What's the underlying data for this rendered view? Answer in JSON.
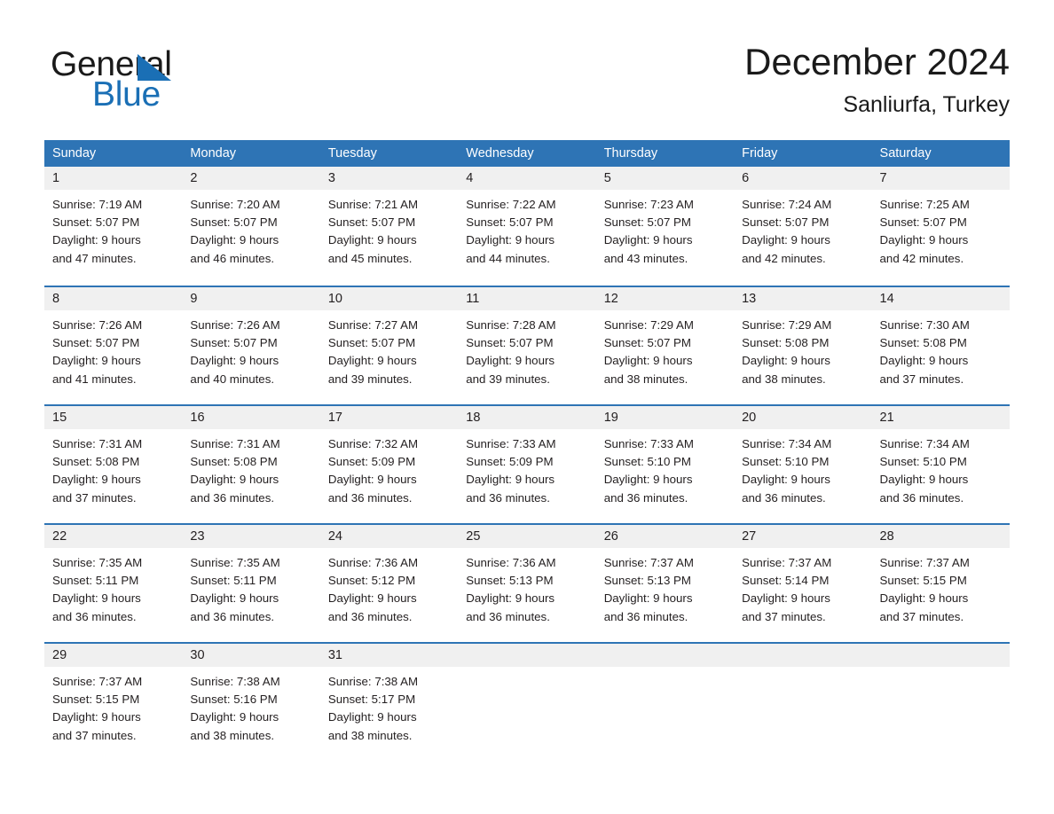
{
  "brand": {
    "word_general": "General",
    "word_blue": "Blue",
    "triangle_color": "#1a6fb5"
  },
  "header": {
    "month_title": "December 2024",
    "location": "Sanliurfa, Turkey"
  },
  "theme": {
    "header_blue": "#2e74b5",
    "day_band_gray": "#f0f0f0",
    "text_color": "#231f20"
  },
  "weekdays": [
    "Sunday",
    "Monday",
    "Tuesday",
    "Wednesday",
    "Thursday",
    "Friday",
    "Saturday"
  ],
  "weeks": [
    [
      {
        "day": "1",
        "sunrise": "Sunrise: 7:19 AM",
        "sunset": "Sunset: 5:07 PM",
        "daylight1": "Daylight: 9 hours",
        "daylight2": "and 47 minutes."
      },
      {
        "day": "2",
        "sunrise": "Sunrise: 7:20 AM",
        "sunset": "Sunset: 5:07 PM",
        "daylight1": "Daylight: 9 hours",
        "daylight2": "and 46 minutes."
      },
      {
        "day": "3",
        "sunrise": "Sunrise: 7:21 AM",
        "sunset": "Sunset: 5:07 PM",
        "daylight1": "Daylight: 9 hours",
        "daylight2": "and 45 minutes."
      },
      {
        "day": "4",
        "sunrise": "Sunrise: 7:22 AM",
        "sunset": "Sunset: 5:07 PM",
        "daylight1": "Daylight: 9 hours",
        "daylight2": "and 44 minutes."
      },
      {
        "day": "5",
        "sunrise": "Sunrise: 7:23 AM",
        "sunset": "Sunset: 5:07 PM",
        "daylight1": "Daylight: 9 hours",
        "daylight2": "and 43 minutes."
      },
      {
        "day": "6",
        "sunrise": "Sunrise: 7:24 AM",
        "sunset": "Sunset: 5:07 PM",
        "daylight1": "Daylight: 9 hours",
        "daylight2": "and 42 minutes."
      },
      {
        "day": "7",
        "sunrise": "Sunrise: 7:25 AM",
        "sunset": "Sunset: 5:07 PM",
        "daylight1": "Daylight: 9 hours",
        "daylight2": "and 42 minutes."
      }
    ],
    [
      {
        "day": "8",
        "sunrise": "Sunrise: 7:26 AM",
        "sunset": "Sunset: 5:07 PM",
        "daylight1": "Daylight: 9 hours",
        "daylight2": "and 41 minutes."
      },
      {
        "day": "9",
        "sunrise": "Sunrise: 7:26 AM",
        "sunset": "Sunset: 5:07 PM",
        "daylight1": "Daylight: 9 hours",
        "daylight2": "and 40 minutes."
      },
      {
        "day": "10",
        "sunrise": "Sunrise: 7:27 AM",
        "sunset": "Sunset: 5:07 PM",
        "daylight1": "Daylight: 9 hours",
        "daylight2": "and 39 minutes."
      },
      {
        "day": "11",
        "sunrise": "Sunrise: 7:28 AM",
        "sunset": "Sunset: 5:07 PM",
        "daylight1": "Daylight: 9 hours",
        "daylight2": "and 39 minutes."
      },
      {
        "day": "12",
        "sunrise": "Sunrise: 7:29 AM",
        "sunset": "Sunset: 5:07 PM",
        "daylight1": "Daylight: 9 hours",
        "daylight2": "and 38 minutes."
      },
      {
        "day": "13",
        "sunrise": "Sunrise: 7:29 AM",
        "sunset": "Sunset: 5:08 PM",
        "daylight1": "Daylight: 9 hours",
        "daylight2": "and 38 minutes."
      },
      {
        "day": "14",
        "sunrise": "Sunrise: 7:30 AM",
        "sunset": "Sunset: 5:08 PM",
        "daylight1": "Daylight: 9 hours",
        "daylight2": "and 37 minutes."
      }
    ],
    [
      {
        "day": "15",
        "sunrise": "Sunrise: 7:31 AM",
        "sunset": "Sunset: 5:08 PM",
        "daylight1": "Daylight: 9 hours",
        "daylight2": "and 37 minutes."
      },
      {
        "day": "16",
        "sunrise": "Sunrise: 7:31 AM",
        "sunset": "Sunset: 5:08 PM",
        "daylight1": "Daylight: 9 hours",
        "daylight2": "and 36 minutes."
      },
      {
        "day": "17",
        "sunrise": "Sunrise: 7:32 AM",
        "sunset": "Sunset: 5:09 PM",
        "daylight1": "Daylight: 9 hours",
        "daylight2": "and 36 minutes."
      },
      {
        "day": "18",
        "sunrise": "Sunrise: 7:33 AM",
        "sunset": "Sunset: 5:09 PM",
        "daylight1": "Daylight: 9 hours",
        "daylight2": "and 36 minutes."
      },
      {
        "day": "19",
        "sunrise": "Sunrise: 7:33 AM",
        "sunset": "Sunset: 5:10 PM",
        "daylight1": "Daylight: 9 hours",
        "daylight2": "and 36 minutes."
      },
      {
        "day": "20",
        "sunrise": "Sunrise: 7:34 AM",
        "sunset": "Sunset: 5:10 PM",
        "daylight1": "Daylight: 9 hours",
        "daylight2": "and 36 minutes."
      },
      {
        "day": "21",
        "sunrise": "Sunrise: 7:34 AM",
        "sunset": "Sunset: 5:10 PM",
        "daylight1": "Daylight: 9 hours",
        "daylight2": "and 36 minutes."
      }
    ],
    [
      {
        "day": "22",
        "sunrise": "Sunrise: 7:35 AM",
        "sunset": "Sunset: 5:11 PM",
        "daylight1": "Daylight: 9 hours",
        "daylight2": "and 36 minutes."
      },
      {
        "day": "23",
        "sunrise": "Sunrise: 7:35 AM",
        "sunset": "Sunset: 5:11 PM",
        "daylight1": "Daylight: 9 hours",
        "daylight2": "and 36 minutes."
      },
      {
        "day": "24",
        "sunrise": "Sunrise: 7:36 AM",
        "sunset": "Sunset: 5:12 PM",
        "daylight1": "Daylight: 9 hours",
        "daylight2": "and 36 minutes."
      },
      {
        "day": "25",
        "sunrise": "Sunrise: 7:36 AM",
        "sunset": "Sunset: 5:13 PM",
        "daylight1": "Daylight: 9 hours",
        "daylight2": "and 36 minutes."
      },
      {
        "day": "26",
        "sunrise": "Sunrise: 7:37 AM",
        "sunset": "Sunset: 5:13 PM",
        "daylight1": "Daylight: 9 hours",
        "daylight2": "and 36 minutes."
      },
      {
        "day": "27",
        "sunrise": "Sunrise: 7:37 AM",
        "sunset": "Sunset: 5:14 PM",
        "daylight1": "Daylight: 9 hours",
        "daylight2": "and 37 minutes."
      },
      {
        "day": "28",
        "sunrise": "Sunrise: 7:37 AM",
        "sunset": "Sunset: 5:15 PM",
        "daylight1": "Daylight: 9 hours",
        "daylight2": "and 37 minutes."
      }
    ],
    [
      {
        "day": "29",
        "sunrise": "Sunrise: 7:37 AM",
        "sunset": "Sunset: 5:15 PM",
        "daylight1": "Daylight: 9 hours",
        "daylight2": "and 37 minutes."
      },
      {
        "day": "30",
        "sunrise": "Sunrise: 7:38 AM",
        "sunset": "Sunset: 5:16 PM",
        "daylight1": "Daylight: 9 hours",
        "daylight2": "and 38 minutes."
      },
      {
        "day": "31",
        "sunrise": "Sunrise: 7:38 AM",
        "sunset": "Sunset: 5:17 PM",
        "daylight1": "Daylight: 9 hours",
        "daylight2": "and 38 minutes."
      },
      {
        "day": "",
        "sunrise": "",
        "sunset": "",
        "daylight1": "",
        "daylight2": ""
      },
      {
        "day": "",
        "sunrise": "",
        "sunset": "",
        "daylight1": "",
        "daylight2": ""
      },
      {
        "day": "",
        "sunrise": "",
        "sunset": "",
        "daylight1": "",
        "daylight2": ""
      },
      {
        "day": "",
        "sunrise": "",
        "sunset": "",
        "daylight1": "",
        "daylight2": ""
      }
    ]
  ]
}
